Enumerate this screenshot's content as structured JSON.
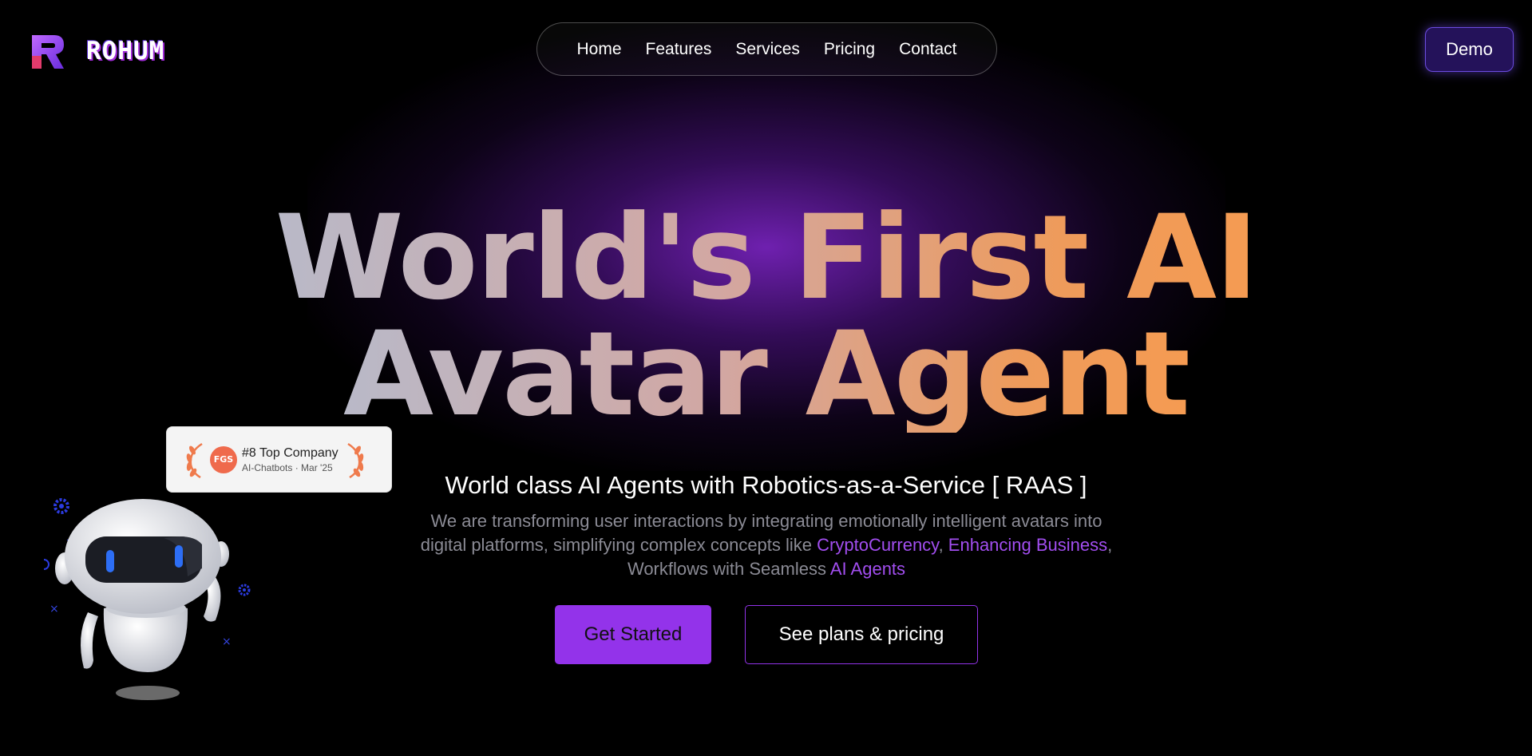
{
  "brand": {
    "name": "ROHUM",
    "accent": "#9333ea"
  },
  "nav": {
    "items": [
      "Home",
      "Features",
      "Services",
      "Pricing",
      "Contact"
    ],
    "demo_label": "Demo"
  },
  "hero": {
    "headline_line1": "World's First AI",
    "headline_line2": "Avatar Agent",
    "subheading": "World class AI Agents with Robotics-as-a-Service [ RAAS ]",
    "description_part1": "We are transforming user interactions by integrating emotionally intelligent avatars into digital platforms, simplifying complex concepts like ",
    "highlight1": "CryptoCurrency",
    "description_part2": ", ",
    "highlight2": "Enhancing Business",
    "description_part3": ", Workflows with Seamless ",
    "highlight3": "AI Agents",
    "primary_button": "Get Started",
    "secondary_button": "See plans & pricing"
  },
  "badge": {
    "seal": "FGS",
    "rank": "#8 Top Company",
    "category": "AI-Chatbots · Mar '25"
  },
  "icons": [
    "logo-mark-icon",
    "laurel-icon",
    "robot-illustration",
    "gear-icon",
    "circle-icon",
    "cross-icon"
  ]
}
